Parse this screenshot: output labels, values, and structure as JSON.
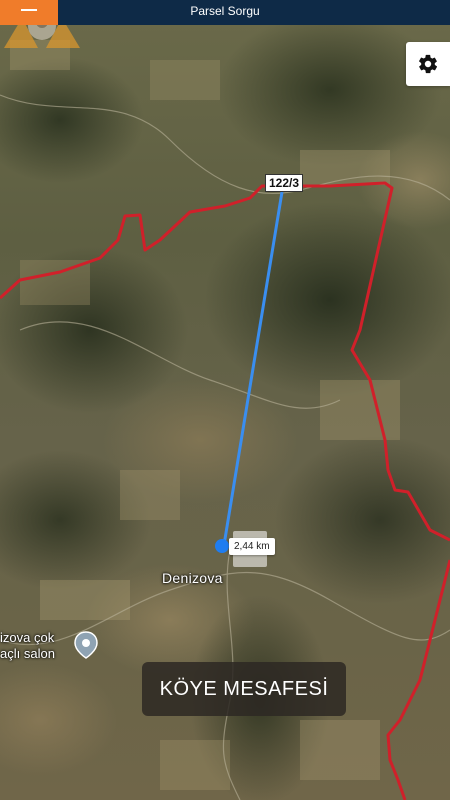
{
  "app": {
    "title": "Parsel Sorgu"
  },
  "header": {
    "menu_icon": "hamburger-icon",
    "settings_icon": "gear-icon"
  },
  "map": {
    "parcel_label": "122/3",
    "distance": "2,44 km",
    "village": "Denizova",
    "poi_lines": [
      "izova çok",
      "açlı salon"
    ],
    "poi_icon": "location-pin-icon",
    "colors": {
      "boundary": "#d0202a",
      "route": "#3a8ef0",
      "header": "#0e2a47",
      "menu": "#f07c2a"
    }
  },
  "caption": {
    "text": "KÖYE MESAFESİ"
  }
}
